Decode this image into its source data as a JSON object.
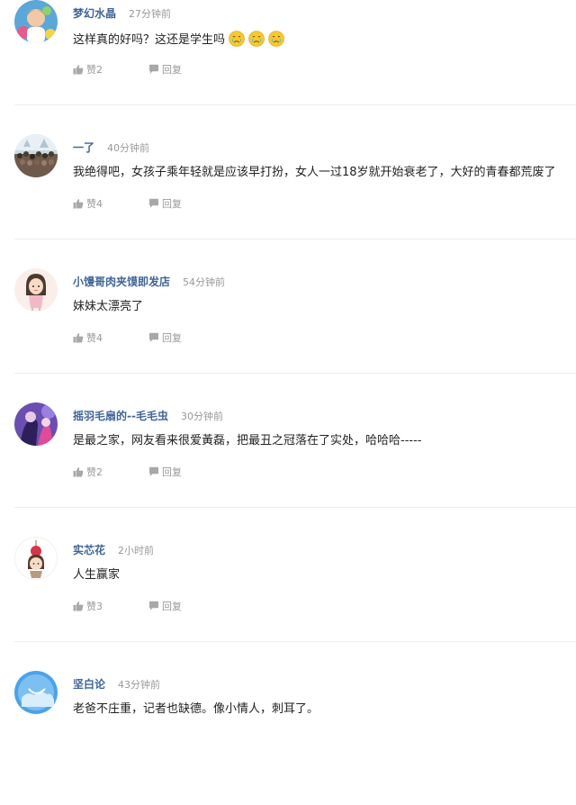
{
  "actions": {
    "like_prefix": "赞",
    "reply_label": "回复"
  },
  "colors": {
    "username": "#406599",
    "muted": "#999999",
    "divider": "#ececec"
  },
  "comments": [
    {
      "username": "梦幻水晶",
      "time": "27分钟前",
      "text": "这样真的好吗？这还是学生吗",
      "emojis": [
        "crying-face-icon",
        "crying-face-icon",
        "crying-face-icon"
      ],
      "likes_label": "赞2",
      "avatar": "avatar-child-photo"
    },
    {
      "username": "一了",
      "time": "40分钟前",
      "text": "我绝得吧，女孩子乘年轻就是应该早打扮，女人一过18岁就开始衰老了，大好的青春都荒废了",
      "likes_label": "赞4",
      "avatar": "avatar-crowd-photo"
    },
    {
      "username": "小馒哥肉夹馍即发店",
      "time": "54分钟前",
      "text": "妹妹太漂亮了",
      "likes_label": "赞4",
      "avatar": "avatar-cartoon-girl"
    },
    {
      "username": "摇羽毛扇的--毛毛虫",
      "time": "30分钟前",
      "text": "是最之家，网友看来很爱黃磊，把最丑之冠落在了实处，哈哈哈-----",
      "likes_label": "赞2",
      "avatar": "avatar-purple-illustration"
    },
    {
      "username": "实芯花",
      "time": "2小时前",
      "text": "人生赢家",
      "likes_label": "赞3",
      "avatar": "avatar-cherry-doll"
    },
    {
      "username": "坚白论",
      "time": "43分钟前",
      "text": "老爸不庄重，记者也缺德。像小情人，刺耳了。",
      "likes_label": "",
      "avatar": "avatar-blue-cloud"
    }
  ]
}
